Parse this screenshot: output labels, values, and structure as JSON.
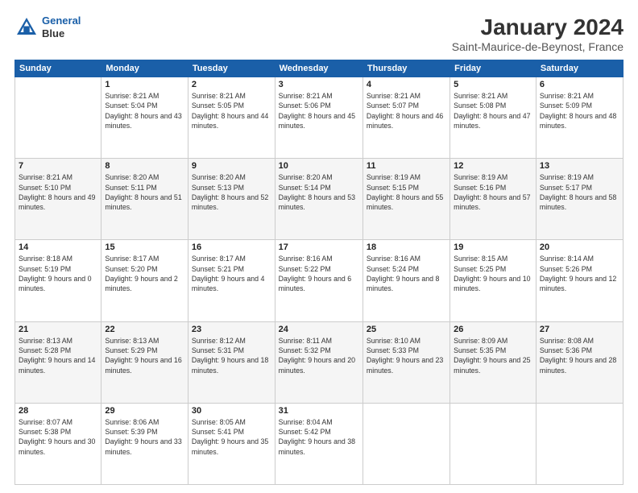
{
  "header": {
    "logo": {
      "line1": "General",
      "line2": "Blue"
    },
    "title": "January 2024",
    "subtitle": "Saint-Maurice-de-Beynost, France"
  },
  "weekdays": [
    "Sunday",
    "Monday",
    "Tuesday",
    "Wednesday",
    "Thursday",
    "Friday",
    "Saturday"
  ],
  "weeks": [
    [
      {
        "day": null
      },
      {
        "day": "1",
        "sunrise": "8:21 AM",
        "sunset": "5:04 PM",
        "daylight": "8 hours and 43 minutes."
      },
      {
        "day": "2",
        "sunrise": "8:21 AM",
        "sunset": "5:05 PM",
        "daylight": "8 hours and 44 minutes."
      },
      {
        "day": "3",
        "sunrise": "8:21 AM",
        "sunset": "5:06 PM",
        "daylight": "8 hours and 45 minutes."
      },
      {
        "day": "4",
        "sunrise": "8:21 AM",
        "sunset": "5:07 PM",
        "daylight": "8 hours and 46 minutes."
      },
      {
        "day": "5",
        "sunrise": "8:21 AM",
        "sunset": "5:08 PM",
        "daylight": "8 hours and 47 minutes."
      },
      {
        "day": "6",
        "sunrise": "8:21 AM",
        "sunset": "5:09 PM",
        "daylight": "8 hours and 48 minutes."
      }
    ],
    [
      {
        "day": "7",
        "sunrise": "8:21 AM",
        "sunset": "5:10 PM",
        "daylight": "8 hours and 49 minutes."
      },
      {
        "day": "8",
        "sunrise": "8:20 AM",
        "sunset": "5:11 PM",
        "daylight": "8 hours and 51 minutes."
      },
      {
        "day": "9",
        "sunrise": "8:20 AM",
        "sunset": "5:13 PM",
        "daylight": "8 hours and 52 minutes."
      },
      {
        "day": "10",
        "sunrise": "8:20 AM",
        "sunset": "5:14 PM",
        "daylight": "8 hours and 53 minutes."
      },
      {
        "day": "11",
        "sunrise": "8:19 AM",
        "sunset": "5:15 PM",
        "daylight": "8 hours and 55 minutes."
      },
      {
        "day": "12",
        "sunrise": "8:19 AM",
        "sunset": "5:16 PM",
        "daylight": "8 hours and 57 minutes."
      },
      {
        "day": "13",
        "sunrise": "8:19 AM",
        "sunset": "5:17 PM",
        "daylight": "8 hours and 58 minutes."
      }
    ],
    [
      {
        "day": "14",
        "sunrise": "8:18 AM",
        "sunset": "5:19 PM",
        "daylight": "9 hours and 0 minutes."
      },
      {
        "day": "15",
        "sunrise": "8:17 AM",
        "sunset": "5:20 PM",
        "daylight": "9 hours and 2 minutes."
      },
      {
        "day": "16",
        "sunrise": "8:17 AM",
        "sunset": "5:21 PM",
        "daylight": "9 hours and 4 minutes."
      },
      {
        "day": "17",
        "sunrise": "8:16 AM",
        "sunset": "5:22 PM",
        "daylight": "9 hours and 6 minutes."
      },
      {
        "day": "18",
        "sunrise": "8:16 AM",
        "sunset": "5:24 PM",
        "daylight": "9 hours and 8 minutes."
      },
      {
        "day": "19",
        "sunrise": "8:15 AM",
        "sunset": "5:25 PM",
        "daylight": "9 hours and 10 minutes."
      },
      {
        "day": "20",
        "sunrise": "8:14 AM",
        "sunset": "5:26 PM",
        "daylight": "9 hours and 12 minutes."
      }
    ],
    [
      {
        "day": "21",
        "sunrise": "8:13 AM",
        "sunset": "5:28 PM",
        "daylight": "9 hours and 14 minutes."
      },
      {
        "day": "22",
        "sunrise": "8:13 AM",
        "sunset": "5:29 PM",
        "daylight": "9 hours and 16 minutes."
      },
      {
        "day": "23",
        "sunrise": "8:12 AM",
        "sunset": "5:31 PM",
        "daylight": "9 hours and 18 minutes."
      },
      {
        "day": "24",
        "sunrise": "8:11 AM",
        "sunset": "5:32 PM",
        "daylight": "9 hours and 20 minutes."
      },
      {
        "day": "25",
        "sunrise": "8:10 AM",
        "sunset": "5:33 PM",
        "daylight": "9 hours and 23 minutes."
      },
      {
        "day": "26",
        "sunrise": "8:09 AM",
        "sunset": "5:35 PM",
        "daylight": "9 hours and 25 minutes."
      },
      {
        "day": "27",
        "sunrise": "8:08 AM",
        "sunset": "5:36 PM",
        "daylight": "9 hours and 28 minutes."
      }
    ],
    [
      {
        "day": "28",
        "sunrise": "8:07 AM",
        "sunset": "5:38 PM",
        "daylight": "9 hours and 30 minutes."
      },
      {
        "day": "29",
        "sunrise": "8:06 AM",
        "sunset": "5:39 PM",
        "daylight": "9 hours and 33 minutes."
      },
      {
        "day": "30",
        "sunrise": "8:05 AM",
        "sunset": "5:41 PM",
        "daylight": "9 hours and 35 minutes."
      },
      {
        "day": "31",
        "sunrise": "8:04 AM",
        "sunset": "5:42 PM",
        "daylight": "9 hours and 38 minutes."
      },
      {
        "day": null
      },
      {
        "day": null
      },
      {
        "day": null
      }
    ]
  ]
}
